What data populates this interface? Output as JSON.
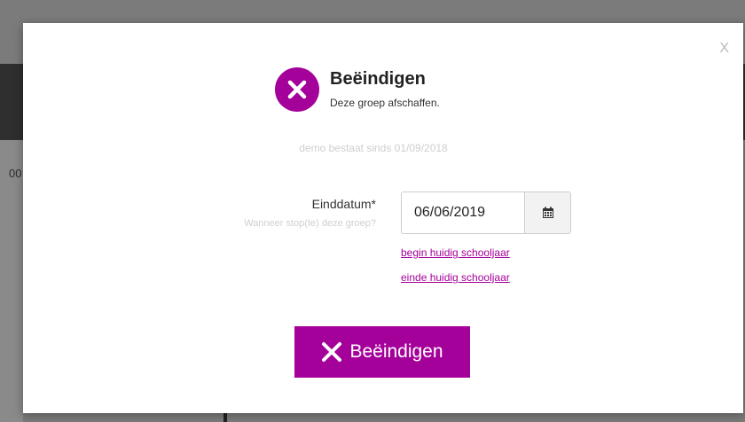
{
  "background": {
    "fragment_text": "00"
  },
  "modal": {
    "close_label": "X",
    "header": {
      "icon": "x-circle-icon",
      "title": "Beëindigen",
      "subtitle": "Deze groep afschaffen."
    },
    "since_text": "demo bestaat sinds 01/09/2018",
    "end_date": {
      "label": "Einddatum*",
      "help": "Wanneer stop(te) deze groep?",
      "value": "06/06/2019",
      "calendar_icon": "calendar-icon"
    },
    "links": {
      "begin": "begin huidig schooljaar",
      "end": "einde huidig schooljaar"
    },
    "submit": {
      "icon": "x-icon",
      "label": "Beëindigen"
    }
  },
  "colors": {
    "accent": "#a4009a",
    "overlay": "#7b7b7b"
  }
}
